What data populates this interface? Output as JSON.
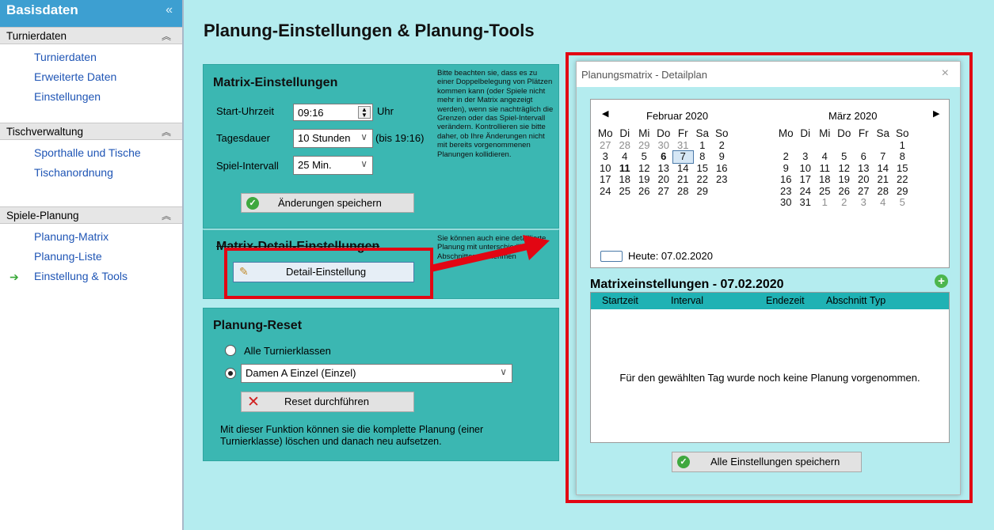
{
  "sidebar": {
    "header": "Basisdaten",
    "groups": [
      {
        "title": "Turnierdaten",
        "items": [
          "Turnierdaten",
          "Erweiterte Daten",
          "Einstellungen"
        ]
      },
      {
        "title": "Tischverwaltung",
        "items": [
          "Sporthalle und Tische",
          "Tischanordnung"
        ]
      },
      {
        "title": "Spiele-Planung",
        "items": [
          "Planung-Matrix",
          "Planung-Liste",
          "Einstellung & Tools"
        ]
      }
    ]
  },
  "page_title": "Planung-Einstellungen & Planung-Tools",
  "matrix_settings": {
    "title": "Matrix-Einstellungen",
    "start_label": "Start-Uhrzeit",
    "start_value": "09:16",
    "start_unit": "Uhr",
    "duration_label": "Tagesdauer",
    "duration_value": "10 Stunden",
    "duration_note": "(bis 19:16)",
    "interval_label": "Spiel-Intervall",
    "interval_value": "25 Min.",
    "save_button": "Änderungen speichern",
    "note": "Bitte beachten sie, dass es zu einer Doppelbelegung von Plätzen kommen kann (oder Spiele nicht mehr in der Matrix angezeigt werden), wenn sie nachträglich die Grenzen oder das Spiel-Intervall verändern. Kontrollieren sie bitte daher, ob Ihre Änderungen nicht mit bereits vorgenommenen Planungen kollidieren."
  },
  "detail_settings": {
    "title": "Matrix-Detail-Einstellungen",
    "button": "Detail-Einstellung",
    "note": "Sie können auch eine detaillierte Planung mit unterschiedlichen Abschnitten vornehmen"
  },
  "planning_reset": {
    "title": "Planung-Reset",
    "option_all": "Alle Turnierklassen",
    "option_selected": "Damen A Einzel (Einzel)",
    "reset_button": "Reset durchführen",
    "note": "Mit dieser Funktion können sie die komplette Planung (einer Turnierklasse) löschen und danach neu aufsetzen."
  },
  "dialog": {
    "title": "Planungsmatrix - Detailplan",
    "close": "×",
    "calendar": {
      "months": [
        "Februar 2020",
        "März 2020"
      ],
      "weekdays": [
        "Mo",
        "Di",
        "Mi",
        "Do",
        "Fr",
        "Sa",
        "So"
      ],
      "feb_rows": [
        [
          "27",
          "28",
          "29",
          "30",
          "31",
          "1",
          "2"
        ],
        [
          "3",
          "4",
          "5",
          "6",
          "7",
          "8",
          "9"
        ],
        [
          "10",
          "11",
          "12",
          "13",
          "14",
          "15",
          "16"
        ],
        [
          "17",
          "18",
          "19",
          "20",
          "21",
          "22",
          "23"
        ],
        [
          "24",
          "25",
          "26",
          "27",
          "28",
          "29",
          ""
        ]
      ],
      "mar_rows": [
        [
          "",
          "",
          "",
          "",
          "",
          "",
          "1"
        ],
        [
          "2",
          "3",
          "4",
          "5",
          "6",
          "7",
          "8"
        ],
        [
          "9",
          "10",
          "11",
          "12",
          "13",
          "14",
          "15"
        ],
        [
          "16",
          "17",
          "18",
          "19",
          "20",
          "21",
          "22"
        ],
        [
          "23",
          "24",
          "25",
          "26",
          "27",
          "28",
          "29"
        ],
        [
          "30",
          "31",
          "1",
          "2",
          "3",
          "4",
          "5"
        ]
      ],
      "today": "Heute: 07.02.2020"
    },
    "matrix_heading": "Matrixeinstellungen - 07.02.2020",
    "columns": [
      "Startzeit",
      "Interval",
      "Endezeit",
      "Abschnitt",
      "Typ"
    ],
    "empty_message": "Für den gewählten Tag wurde noch keine Planung vorgenommen.",
    "save_all": "Alle Einstellungen speichern"
  },
  "colors": {
    "sidebar_header": "#3d9fd1",
    "link": "#1f55b5",
    "panel": "#3bb7b2",
    "background": "#b4ecef",
    "grid_header": "#1fb2b4",
    "highlight": "#e20613"
  }
}
